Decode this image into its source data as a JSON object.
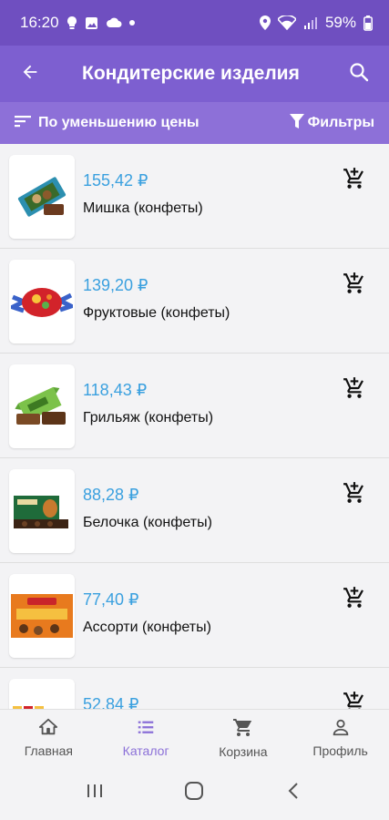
{
  "status_bar": {
    "time": "16:20",
    "battery": "59%"
  },
  "app_bar": {
    "title": "Кондитерские изделия"
  },
  "filter_bar": {
    "sort_label": "По уменьшению цены",
    "filters_label": "Фильтры"
  },
  "products": [
    {
      "price": "155,42 ₽",
      "name": "Мишка (конфеты)"
    },
    {
      "price": "139,20 ₽",
      "name": "Фруктовые (конфеты)"
    },
    {
      "price": "118,43 ₽",
      "name": "Грильяж (конфеты)"
    },
    {
      "price": "88,28 ₽",
      "name": "Белочка (конфеты)"
    },
    {
      "price": "77,40 ₽",
      "name": "Ассорти (конфеты)"
    },
    {
      "price": "52,84 ₽",
      "name": ""
    }
  ],
  "bottom_nav": {
    "items": [
      {
        "label": "Главная",
        "icon": "home-icon"
      },
      {
        "label": "Каталог",
        "icon": "catalog-list-icon"
      },
      {
        "label": "Корзина",
        "icon": "cart-icon"
      },
      {
        "label": "Профиль",
        "icon": "profile-icon"
      }
    ],
    "active_index": 1
  },
  "colors": {
    "status_bar": "#6f4fc0",
    "app_bar": "#7d5fd0",
    "filter_bar": "#8d70d8",
    "price": "#3aa0df",
    "nav_active": "#8b70d8"
  }
}
